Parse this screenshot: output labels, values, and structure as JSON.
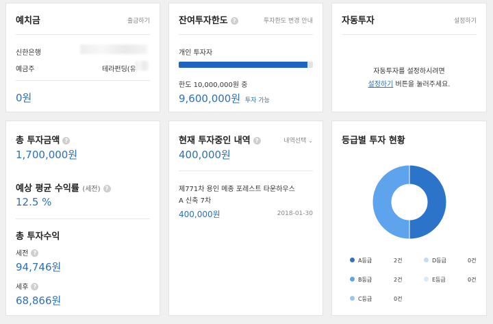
{
  "deposit": {
    "title": "예치금",
    "withdraw_link": "출금하기",
    "bank_label": "신한은행",
    "holder_label": "예금주",
    "holder_value": "테라펀딩(유",
    "amount": "0원"
  },
  "limit": {
    "title": "잔여투자한도",
    "guide_link": "투자한도 변경 안내",
    "investor_type": "개인 투자자",
    "usage_fraction": 0.96,
    "limit_text": "한도 10,000,000원 중",
    "available_amount": "9,600,000원",
    "available_label": "투자 가능"
  },
  "auto_invest": {
    "title": "자동투자",
    "settings_link": "설정하기",
    "message_line1": "자동투자를 설정하시려면",
    "message_link": "설정하기",
    "message_line2_suffix": " 버튼을 눌러주세요."
  },
  "total_invest": {
    "title": "총 투자금액",
    "amount": "1,700,000원",
    "avg_return_title": "예상 평균 수익률",
    "avg_return_note": "(세전)",
    "avg_return_value": "12.5 %",
    "total_return_title": "총 투자수익",
    "pretax_label": "세전",
    "pretax_value": "94,746원",
    "aftertax_label": "세후",
    "aftertax_value": "68,866원"
  },
  "current": {
    "title": "현재 투자중인 내역",
    "dropdown_label": "내역선택",
    "total": "400,000원",
    "item_name_line1": "제771차 용인 메종 포레스트 타운하우스",
    "item_name_line2": "A 신축 7차",
    "item_amount": "400,000원",
    "item_date": "2018-01-30"
  },
  "grade": {
    "title": "등급별 투자 현황",
    "legend": [
      {
        "label": "A등급",
        "count": "2건",
        "color": "#2b74c9"
      },
      {
        "label": "D등급",
        "count": "0건",
        "color": "#c3dbf3"
      },
      {
        "label": "B등급",
        "count": "2건",
        "color": "#5da4ec"
      },
      {
        "label": "E등급",
        "count": "0건",
        "color": "#dbe9f6"
      },
      {
        "label": "C등급",
        "count": "0건",
        "color": "#9cc6f2"
      }
    ],
    "chart_data": {
      "type": "pie",
      "categories": [
        "A등급",
        "B등급",
        "C등급",
        "D등급",
        "E등급"
      ],
      "values": [
        2,
        2,
        0,
        0,
        0
      ],
      "colors": [
        "#2b74c9",
        "#5da4ec",
        "#9cc6f2",
        "#c3dbf3",
        "#dbe9f6"
      ]
    }
  },
  "icons": {
    "help": "question-circle-icon",
    "dropdown": "chevron-down-icon"
  }
}
